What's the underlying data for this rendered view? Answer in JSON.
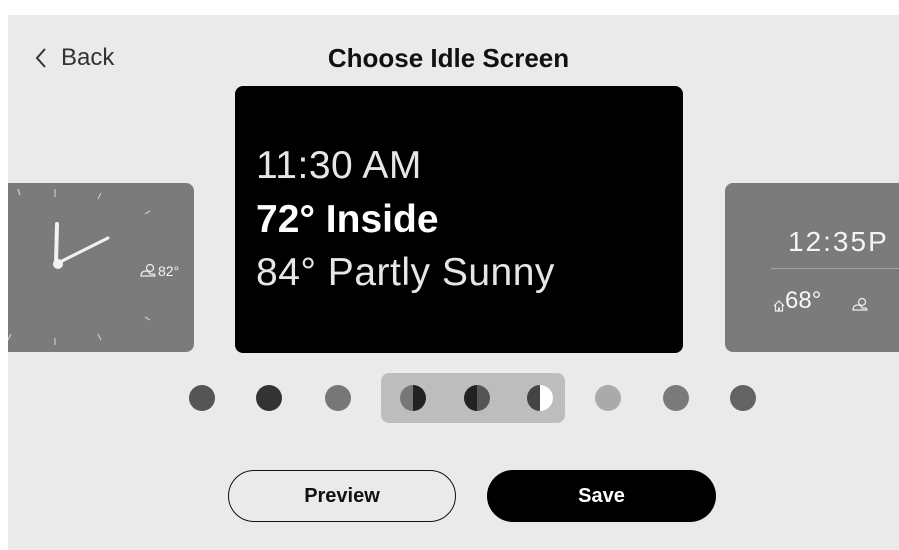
{
  "header": {
    "back_label": "Back",
    "title": "Choose Idle Screen"
  },
  "center_preview": {
    "time": "11:30 AM",
    "inside_temp": "72° Inside",
    "outside": "84° Partly Sunny"
  },
  "left_preview": {
    "style": "analog clock",
    "weather_temp": "82°"
  },
  "right_preview": {
    "time": "12:35",
    "time_suffix": "P",
    "inside_temp": "68°"
  },
  "style_dots": [
    {
      "id": "dot-1",
      "color": "#555555",
      "kind": "solid"
    },
    {
      "id": "dot-2",
      "color": "#333333",
      "kind": "solid"
    },
    {
      "id": "dot-3",
      "color": "#777777",
      "kind": "solid"
    },
    {
      "id": "dot-4",
      "left": "#777777",
      "right": "#222222",
      "kind": "half",
      "selected": true
    },
    {
      "id": "dot-5",
      "left": "#222222",
      "right": "#555555",
      "kind": "half",
      "selected": true
    },
    {
      "id": "dot-6",
      "left": "#444444",
      "right": "#ffffff",
      "kind": "half",
      "selected": true
    },
    {
      "id": "dot-7",
      "color": "#aaaaaa",
      "kind": "solid"
    },
    {
      "id": "dot-8",
      "color": "#7a7a7a",
      "kind": "solid"
    },
    {
      "id": "dot-9",
      "color": "#636363",
      "kind": "solid"
    }
  ],
  "actions": {
    "preview_label": "Preview",
    "save_label": "Save"
  },
  "icons": [
    "chevron-left-icon",
    "partly-sunny-icon",
    "home-icon"
  ]
}
